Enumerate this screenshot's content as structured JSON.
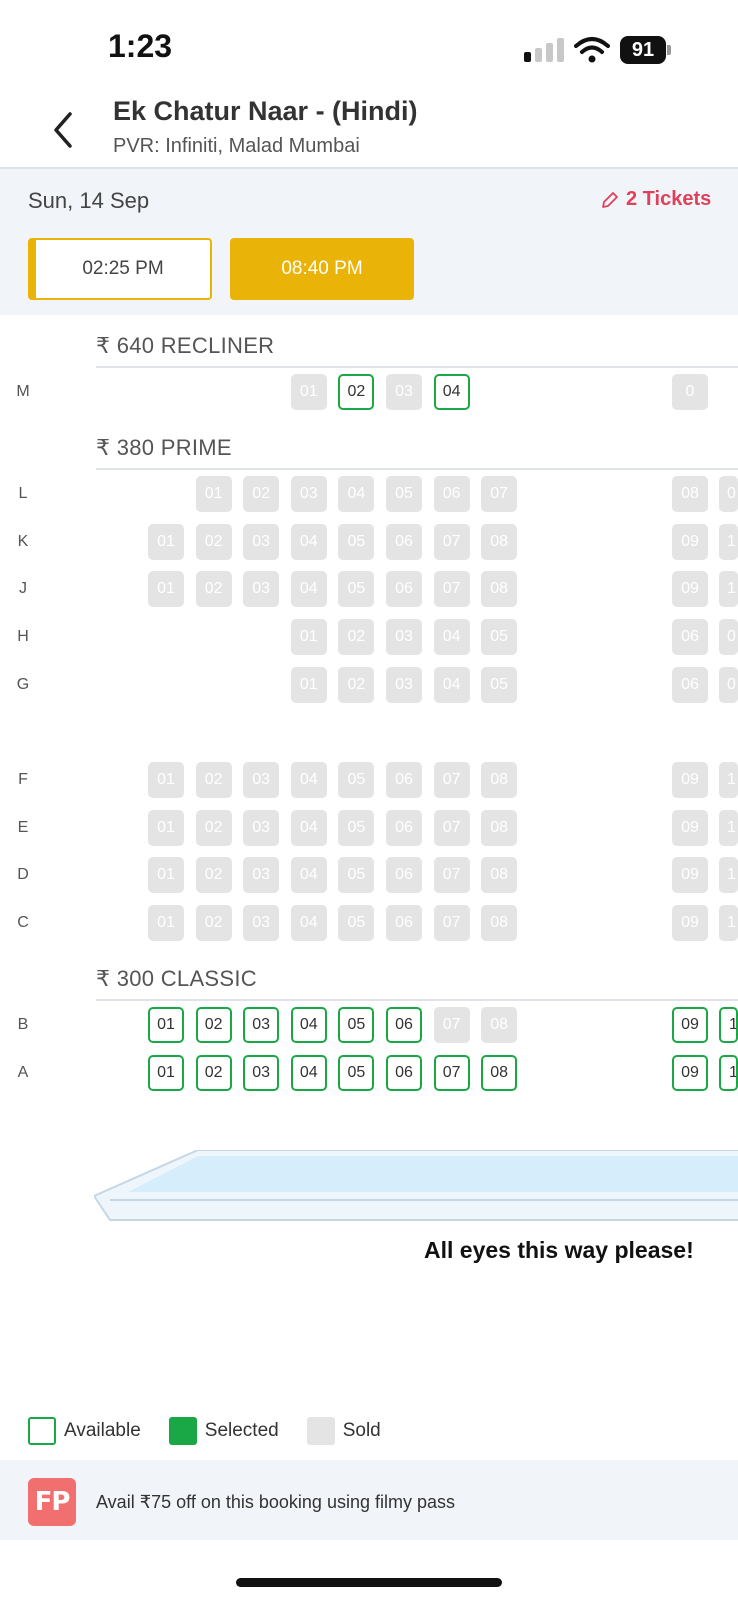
{
  "status_bar": {
    "time": "1:23",
    "battery": "91"
  },
  "header": {
    "movie_title": "Ek Chatur Naar - (Hindi)",
    "venue": "PVR: Infiniti, Malad Mumbai"
  },
  "session": {
    "date": "Sun, 14 Sep",
    "tickets_label": "2 Tickets",
    "showtimes": [
      {
        "time": "02:25 PM",
        "state": "highlighted"
      },
      {
        "time": "08:40 PM",
        "state": "selected"
      }
    ]
  },
  "categories": [
    {
      "label": "₹ 640 RECLINER"
    },
    {
      "label": "₹ 380 PRIME"
    },
    {
      "label": "₹ 300 CLASSIC"
    }
  ],
  "rows": [
    {
      "row": "M",
      "seats": [
        {
          "n": "01",
          "s": "sold"
        },
        {
          "n": "02",
          "s": "available"
        },
        {
          "n": "03",
          "s": "sold"
        },
        {
          "n": "04",
          "s": "available"
        }
      ],
      "right_seats": [
        {
          "n": "0",
          "s": "sold"
        }
      ]
    },
    {
      "row": "L",
      "seats": [
        {
          "n": "01",
          "s": "sold"
        },
        {
          "n": "02",
          "s": "sold"
        },
        {
          "n": "03",
          "s": "sold"
        },
        {
          "n": "04",
          "s": "sold"
        },
        {
          "n": "05",
          "s": "sold"
        },
        {
          "n": "06",
          "s": "sold"
        },
        {
          "n": "07",
          "s": "sold"
        }
      ],
      "right_seats": [
        {
          "n": "08",
          "s": "sold"
        },
        {
          "n": "0",
          "s": "sold"
        }
      ]
    },
    {
      "row": "K",
      "seats": [
        {
          "n": "01",
          "s": "sold"
        },
        {
          "n": "02",
          "s": "sold"
        },
        {
          "n": "03",
          "s": "sold"
        },
        {
          "n": "04",
          "s": "sold"
        },
        {
          "n": "05",
          "s": "sold"
        },
        {
          "n": "06",
          "s": "sold"
        },
        {
          "n": "07",
          "s": "sold"
        },
        {
          "n": "08",
          "s": "sold"
        }
      ],
      "right_seats": [
        {
          "n": "09",
          "s": "sold"
        },
        {
          "n": "1",
          "s": "sold"
        }
      ]
    },
    {
      "row": "J",
      "seats": [
        {
          "n": "01",
          "s": "sold"
        },
        {
          "n": "02",
          "s": "sold"
        },
        {
          "n": "03",
          "s": "sold"
        },
        {
          "n": "04",
          "s": "sold"
        },
        {
          "n": "05",
          "s": "sold"
        },
        {
          "n": "06",
          "s": "sold"
        },
        {
          "n": "07",
          "s": "sold"
        },
        {
          "n": "08",
          "s": "sold"
        }
      ],
      "right_seats": [
        {
          "n": "09",
          "s": "sold"
        },
        {
          "n": "1",
          "s": "sold"
        }
      ]
    },
    {
      "row": "H",
      "seats": [
        {
          "n": "01",
          "s": "sold"
        },
        {
          "n": "02",
          "s": "sold"
        },
        {
          "n": "03",
          "s": "sold"
        },
        {
          "n": "04",
          "s": "sold"
        },
        {
          "n": "05",
          "s": "sold"
        }
      ],
      "right_seats": [
        {
          "n": "06",
          "s": "sold"
        },
        {
          "n": "0",
          "s": "sold"
        }
      ]
    },
    {
      "row": "G",
      "seats": [
        {
          "n": "01",
          "s": "sold"
        },
        {
          "n": "02",
          "s": "sold"
        },
        {
          "n": "03",
          "s": "sold"
        },
        {
          "n": "04",
          "s": "sold"
        },
        {
          "n": "05",
          "s": "sold"
        }
      ],
      "right_seats": [
        {
          "n": "06",
          "s": "sold"
        },
        {
          "n": "0",
          "s": "sold"
        }
      ]
    },
    {
      "row": "F",
      "seats": [
        {
          "n": "01",
          "s": "sold"
        },
        {
          "n": "02",
          "s": "sold"
        },
        {
          "n": "03",
          "s": "sold"
        },
        {
          "n": "04",
          "s": "sold"
        },
        {
          "n": "05",
          "s": "sold"
        },
        {
          "n": "06",
          "s": "sold"
        },
        {
          "n": "07",
          "s": "sold"
        },
        {
          "n": "08",
          "s": "sold"
        }
      ],
      "right_seats": [
        {
          "n": "09",
          "s": "sold"
        },
        {
          "n": "1",
          "s": "sold"
        }
      ]
    },
    {
      "row": "E",
      "seats": [
        {
          "n": "01",
          "s": "sold"
        },
        {
          "n": "02",
          "s": "sold"
        },
        {
          "n": "03",
          "s": "sold"
        },
        {
          "n": "04",
          "s": "sold"
        },
        {
          "n": "05",
          "s": "sold"
        },
        {
          "n": "06",
          "s": "sold"
        },
        {
          "n": "07",
          "s": "sold"
        },
        {
          "n": "08",
          "s": "sold"
        }
      ],
      "right_seats": [
        {
          "n": "09",
          "s": "sold"
        },
        {
          "n": "1",
          "s": "sold"
        }
      ]
    },
    {
      "row": "D",
      "seats": [
        {
          "n": "01",
          "s": "sold"
        },
        {
          "n": "02",
          "s": "sold"
        },
        {
          "n": "03",
          "s": "sold"
        },
        {
          "n": "04",
          "s": "sold"
        },
        {
          "n": "05",
          "s": "sold"
        },
        {
          "n": "06",
          "s": "sold"
        },
        {
          "n": "07",
          "s": "sold"
        },
        {
          "n": "08",
          "s": "sold"
        }
      ],
      "right_seats": [
        {
          "n": "09",
          "s": "sold"
        },
        {
          "n": "1",
          "s": "sold"
        }
      ]
    },
    {
      "row": "C",
      "seats": [
        {
          "n": "01",
          "s": "sold"
        },
        {
          "n": "02",
          "s": "sold"
        },
        {
          "n": "03",
          "s": "sold"
        },
        {
          "n": "04",
          "s": "sold"
        },
        {
          "n": "05",
          "s": "sold"
        },
        {
          "n": "06",
          "s": "sold"
        },
        {
          "n": "07",
          "s": "sold"
        },
        {
          "n": "08",
          "s": "sold"
        }
      ],
      "right_seats": [
        {
          "n": "09",
          "s": "sold"
        },
        {
          "n": "1",
          "s": "sold"
        }
      ]
    },
    {
      "row": "B",
      "seats": [
        {
          "n": "01",
          "s": "available"
        },
        {
          "n": "02",
          "s": "available"
        },
        {
          "n": "03",
          "s": "available"
        },
        {
          "n": "04",
          "s": "available"
        },
        {
          "n": "05",
          "s": "available"
        },
        {
          "n": "06",
          "s": "available"
        },
        {
          "n": "07",
          "s": "sold"
        },
        {
          "n": "08",
          "s": "sold"
        }
      ],
      "right_seats": [
        {
          "n": "09",
          "s": "available"
        },
        {
          "n": "1",
          "s": "available"
        }
      ]
    },
    {
      "row": "A",
      "seats": [
        {
          "n": "01",
          "s": "available"
        },
        {
          "n": "02",
          "s": "available"
        },
        {
          "n": "03",
          "s": "available"
        },
        {
          "n": "04",
          "s": "available"
        },
        {
          "n": "05",
          "s": "available"
        },
        {
          "n": "06",
          "s": "available"
        },
        {
          "n": "07",
          "s": "available"
        },
        {
          "n": "08",
          "s": "available"
        }
      ],
      "right_seats": [
        {
          "n": "09",
          "s": "available"
        },
        {
          "n": "1",
          "s": "available"
        }
      ]
    }
  ],
  "screen_caption": "All eyes this way please!",
  "legend": {
    "available": "Available",
    "selected": "Selected",
    "sold": "Sold"
  },
  "promo": {
    "badge": "FP",
    "text": "Avail ₹75 off on this booking using filmy pass"
  },
  "colors": {
    "accent": "#eab308",
    "available_border": "#1aa847",
    "sold": "#e4e4e4",
    "tickets": "#e0415a",
    "screen": "#d6eefc"
  }
}
